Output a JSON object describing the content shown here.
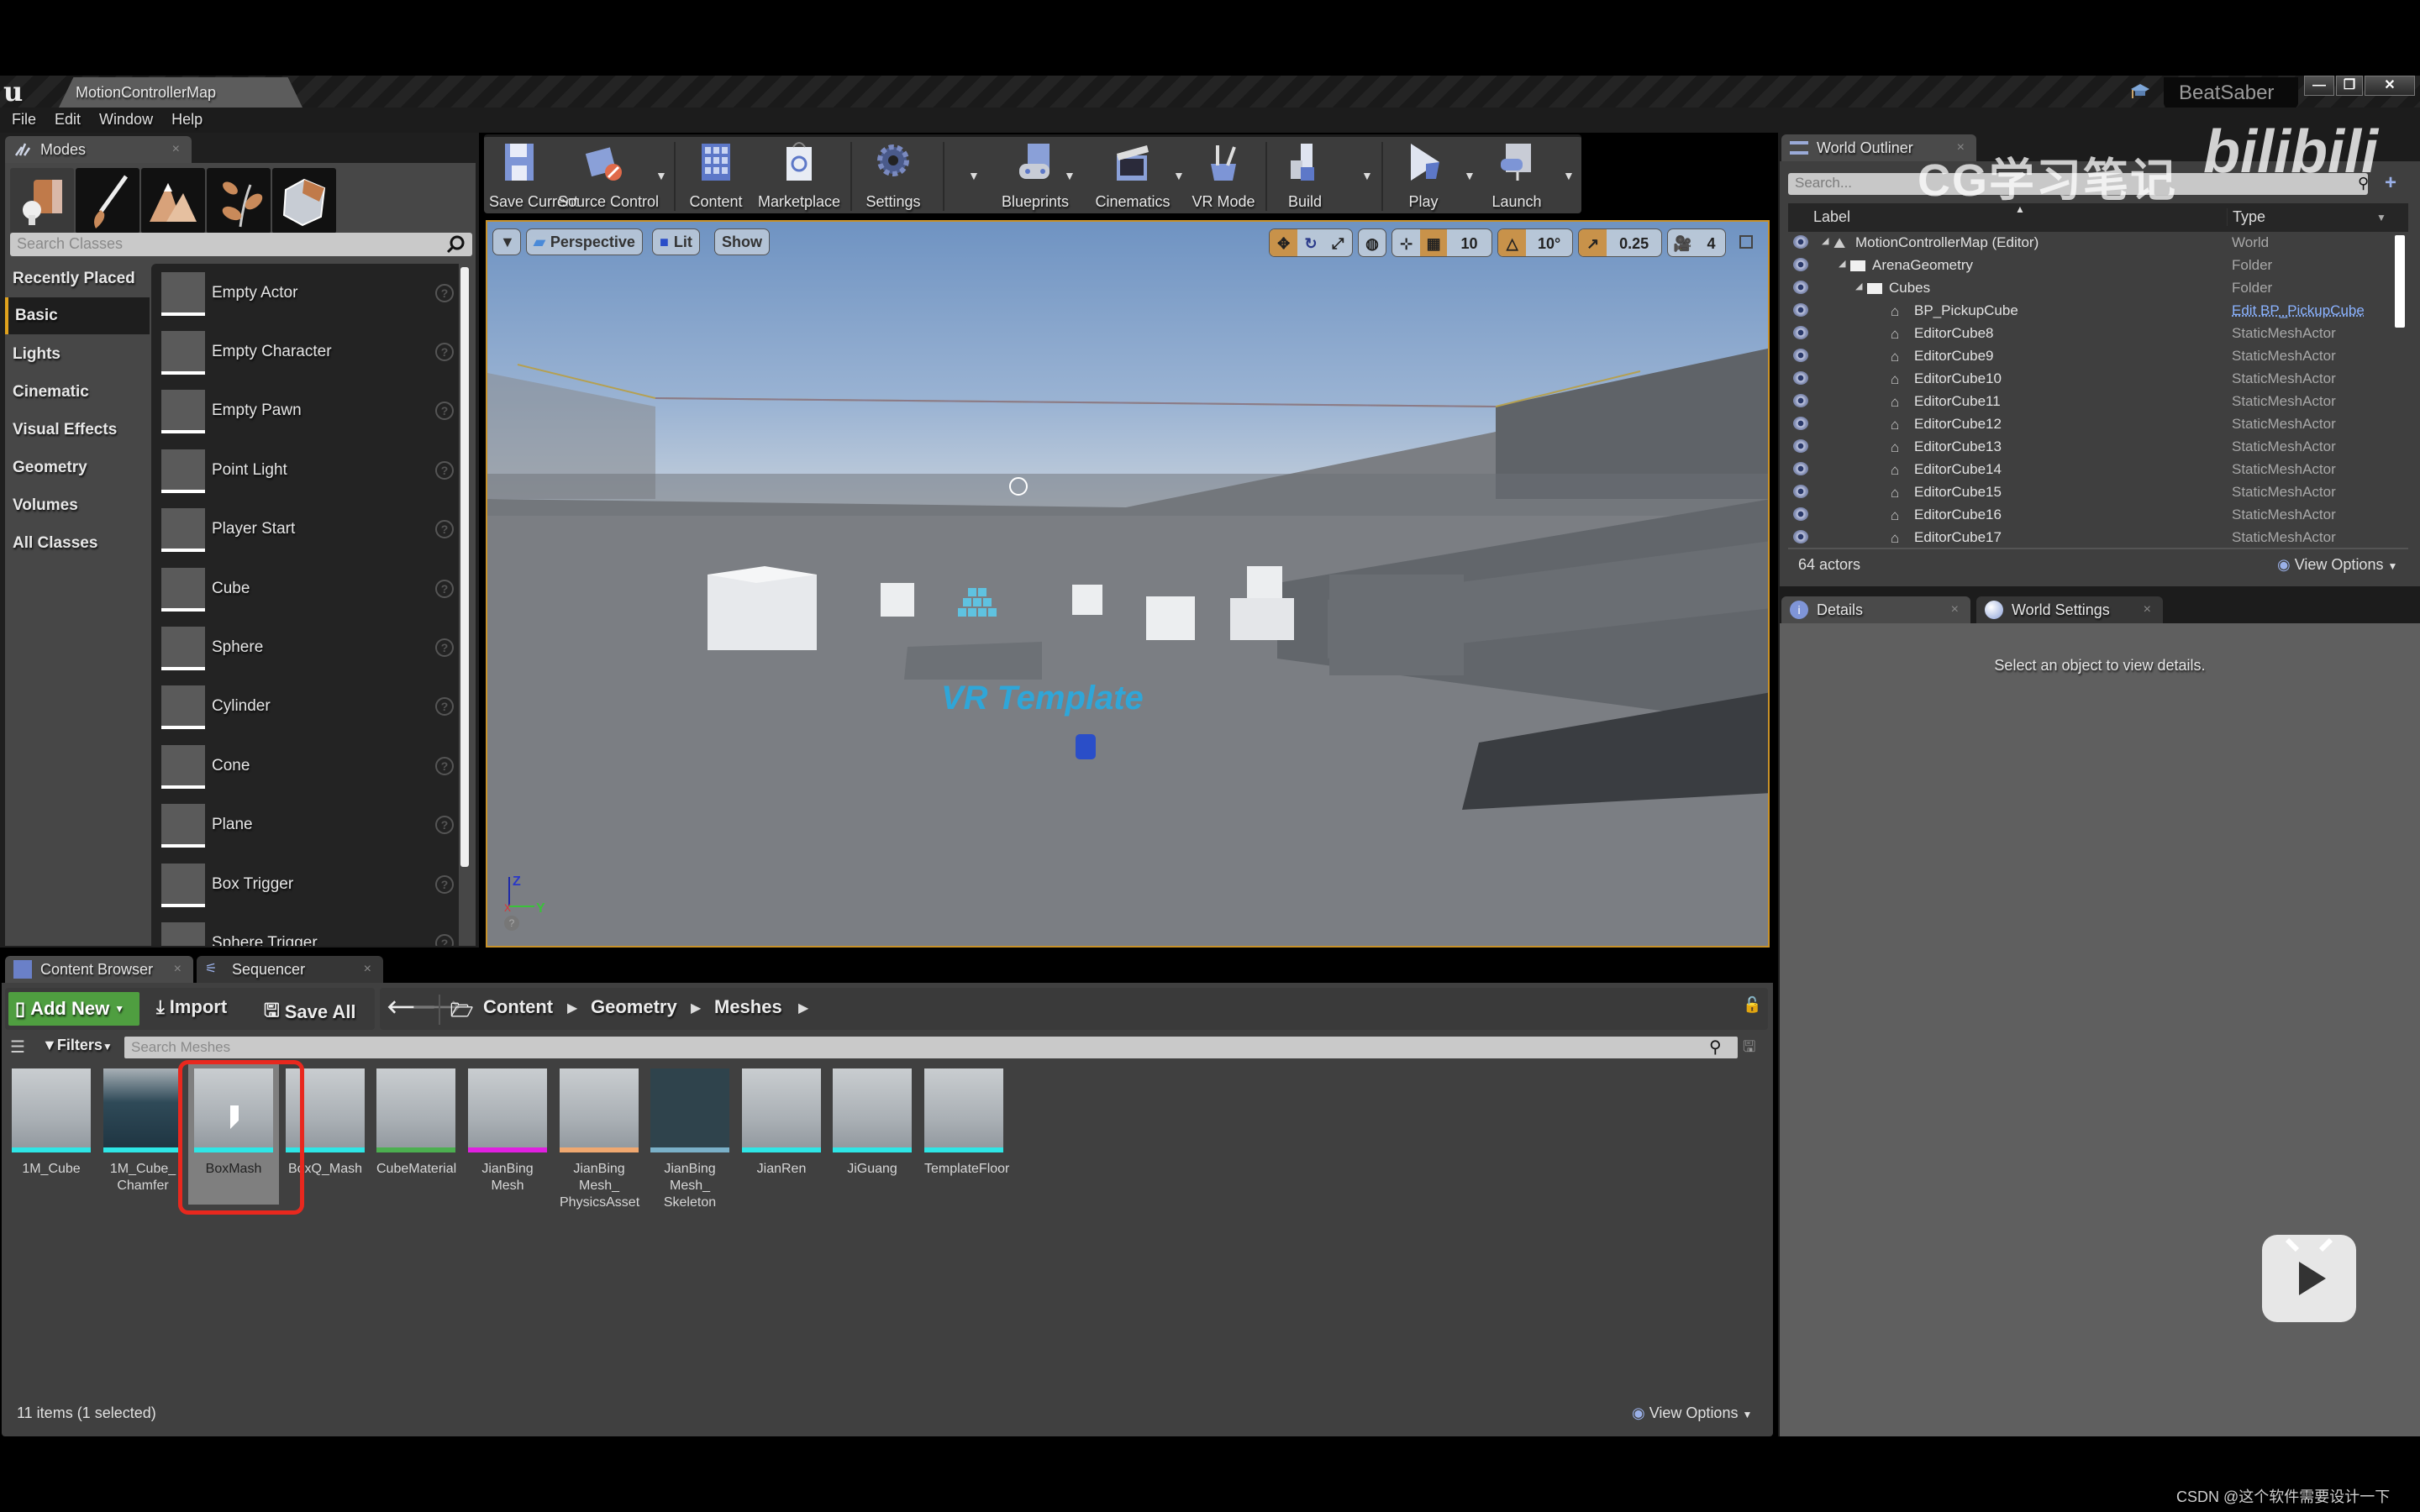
{
  "window": {
    "document_tab": "MotionControllerMap",
    "project_name": "BeatSaber",
    "controls": [
      "minimize",
      "restore",
      "close"
    ]
  },
  "menu": [
    "File",
    "Edit",
    "Window",
    "Help"
  ],
  "modes": {
    "tab_label": "Modes",
    "mode_buttons": [
      "place-mode",
      "paint-mode",
      "landscape-mode",
      "foliage-mode",
      "geometry-edit-mode"
    ],
    "search_placeholder": "Search Classes",
    "categories": [
      {
        "label": "Recently Placed",
        "active": false
      },
      {
        "label": "Basic",
        "active": true
      },
      {
        "label": "Lights",
        "active": false
      },
      {
        "label": "Cinematic",
        "active": false
      },
      {
        "label": "Visual Effects",
        "active": false
      },
      {
        "label": "Geometry",
        "active": false
      },
      {
        "label": "Volumes",
        "active": false
      },
      {
        "label": "All Classes",
        "active": false
      }
    ],
    "classes": [
      "Empty Actor",
      "Empty Character",
      "Empty Pawn",
      "Point Light",
      "Player Start",
      "Cube",
      "Sphere",
      "Cylinder",
      "Cone",
      "Plane",
      "Box Trigger",
      "Sphere Trigger"
    ]
  },
  "toolbar": [
    {
      "label": "Save Current",
      "icon": "floppy-disk-icon",
      "dropdown": false
    },
    {
      "label": "Source Control",
      "icon": "source-control-icon",
      "dropdown": true
    },
    {
      "label": "Content",
      "icon": "content-grid-icon",
      "dropdown": false
    },
    {
      "label": "Marketplace",
      "icon": "marketplace-bag-icon",
      "dropdown": false
    },
    {
      "label": "Settings",
      "icon": "gear-icon",
      "dropdown": true
    },
    {
      "label": "Blueprints",
      "icon": "gamepad-icon",
      "dropdown": true
    },
    {
      "label": "Cinematics",
      "icon": "clapperboard-icon",
      "dropdown": true
    },
    {
      "label": "VR Mode",
      "icon": "vr-tools-icon",
      "dropdown": false
    },
    {
      "label": "Build",
      "icon": "build-blocks-icon",
      "dropdown": true
    },
    {
      "label": "Play",
      "icon": "play-icon",
      "dropdown": true
    },
    {
      "label": "Launch",
      "icon": "launch-icon",
      "dropdown": true
    }
  ],
  "viewport": {
    "view_mode": "Perspective",
    "lighting": "Lit",
    "show": "Show",
    "grid_snap": "10",
    "rotation_snap": "10°",
    "scale_snap": "0.25",
    "camera_speed": "4",
    "floor_text": "VR Template",
    "axis_labels": {
      "z": "Z",
      "y": "Y",
      "x": "X"
    }
  },
  "outliner": {
    "tab_label": "World Outliner",
    "search_placeholder": "Search...",
    "col_label": "Label",
    "col_type": "Type",
    "rows": [
      {
        "label": "MotionControllerMap (Editor)",
        "type": "World",
        "indent": 0,
        "kind": "world",
        "link": false
      },
      {
        "label": "ArenaGeometry",
        "type": "Folder",
        "indent": 1,
        "kind": "folder",
        "link": false
      },
      {
        "label": "Cubes",
        "type": "Folder",
        "indent": 2,
        "kind": "folder",
        "link": false
      },
      {
        "label": "BP_PickupCube",
        "type": "Edit BP_PickupCube",
        "indent": 3,
        "kind": "actor",
        "link": true
      },
      {
        "label": "EditorCube8",
        "type": "StaticMeshActor",
        "indent": 3,
        "kind": "actor",
        "link": false
      },
      {
        "label": "EditorCube9",
        "type": "StaticMeshActor",
        "indent": 3,
        "kind": "actor",
        "link": false
      },
      {
        "label": "EditorCube10",
        "type": "StaticMeshActor",
        "indent": 3,
        "kind": "actor",
        "link": false
      },
      {
        "label": "EditorCube11",
        "type": "StaticMeshActor",
        "indent": 3,
        "kind": "actor",
        "link": false
      },
      {
        "label": "EditorCube12",
        "type": "StaticMeshActor",
        "indent": 3,
        "kind": "actor",
        "link": false
      },
      {
        "label": "EditorCube13",
        "type": "StaticMeshActor",
        "indent": 3,
        "kind": "actor",
        "link": false
      },
      {
        "label": "EditorCube14",
        "type": "StaticMeshActor",
        "indent": 3,
        "kind": "actor",
        "link": false
      },
      {
        "label": "EditorCube15",
        "type": "StaticMeshActor",
        "indent": 3,
        "kind": "actor",
        "link": false
      },
      {
        "label": "EditorCube16",
        "type": "StaticMeshActor",
        "indent": 3,
        "kind": "actor",
        "link": false
      },
      {
        "label": "EditorCube17",
        "type": "StaticMeshActor",
        "indent": 3,
        "kind": "actor",
        "link": false
      }
    ],
    "actor_count": "64 actors",
    "view_options": "View Options"
  },
  "details": {
    "tab_label": "Details",
    "world_settings_label": "World Settings",
    "empty_message": "Select an object to view details."
  },
  "content_browser": {
    "tab_label": "Content Browser",
    "sequencer_label": "Sequencer",
    "add_new": "Add New",
    "import": "Import",
    "save_all": "Save All",
    "breadcrumb": [
      "Content",
      "Geometry",
      "Meshes"
    ],
    "filters": "Filters",
    "search_placeholder": "Search Meshes",
    "assets": [
      {
        "name": "1M_Cube",
        "color": "#2ee6e6",
        "selected": false
      },
      {
        "name": "1M_Cube_ Chamfer",
        "color": "#2ee6e6",
        "selected": false
      },
      {
        "name": "BoxMash",
        "color": "#2ee6e6",
        "selected": true
      },
      {
        "name": "BoxQ_Mash",
        "color": "#2ee6e6",
        "selected": false
      },
      {
        "name": "CubeMaterial",
        "color": "#4caf50",
        "selected": false
      },
      {
        "name": "JianBing Mesh",
        "color": "#e020e0",
        "selected": false
      },
      {
        "name": "JianBing Mesh_ PhysicsAsset",
        "color": "#f0a870",
        "selected": false
      },
      {
        "name": "JianBing Mesh_ Skeleton",
        "color": "#7ab0c8",
        "selected": false
      },
      {
        "name": "JianRen",
        "color": "#2ee6e6",
        "selected": false
      },
      {
        "name": "JiGuang",
        "color": "#2ee6e6",
        "selected": false
      },
      {
        "name": "TemplateFloor",
        "color": "#2ee6e6",
        "selected": false
      }
    ],
    "status": "11 items (1 selected)",
    "view_options": "View Options"
  },
  "watermarks": {
    "cg": "CG学习笔记",
    "bili": "bilibili",
    "csdn": "CSDN @这个软件需要设计一下"
  },
  "colors": {
    "accent_orange": "#c8922a",
    "add_new_green": "#4f9e40",
    "link_blue": "#8ab2ff",
    "selection_red": "#e8281e"
  }
}
